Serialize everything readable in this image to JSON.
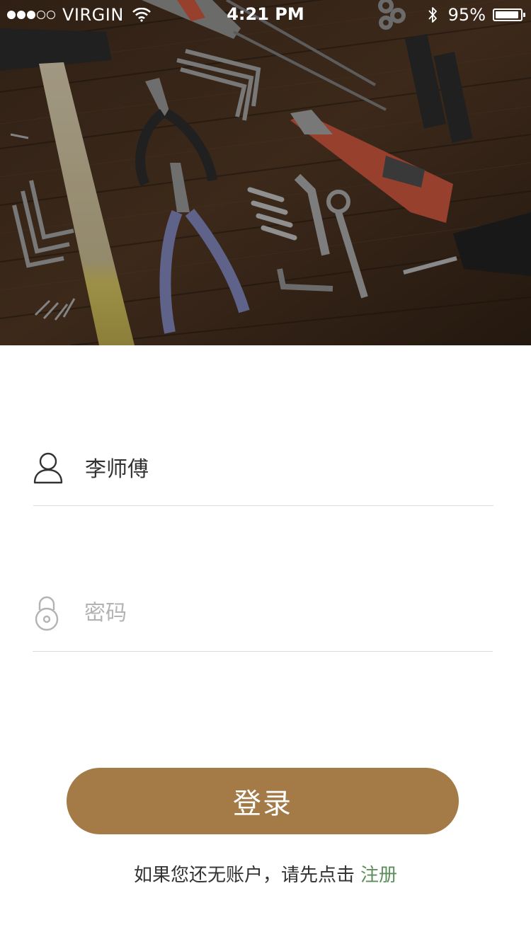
{
  "status_bar": {
    "carrier": "VIRGIN",
    "signal_filled": 3,
    "signal_total": 5,
    "time": "4:21 PM",
    "battery_percent": "95%",
    "battery_level": 0.95,
    "wifi_icon": "wifi-icon",
    "bluetooth_icon": "bluetooth-icon"
  },
  "hero": {
    "icon": "tools-on-wood-photo"
  },
  "form": {
    "username": {
      "icon": "user-icon",
      "value": "李师傅",
      "placeholder": ""
    },
    "password": {
      "icon": "lock-icon",
      "value": "",
      "placeholder": "密码"
    }
  },
  "login_button": {
    "label": "登录"
  },
  "register": {
    "prompt": "如果您还无账户，请先点击",
    "link_label": "注册"
  },
  "colors": {
    "accent": "#a47a47",
    "link": "#5b8f5b",
    "divider": "#dcdcdc",
    "placeholder": "#b3b3b3"
  }
}
